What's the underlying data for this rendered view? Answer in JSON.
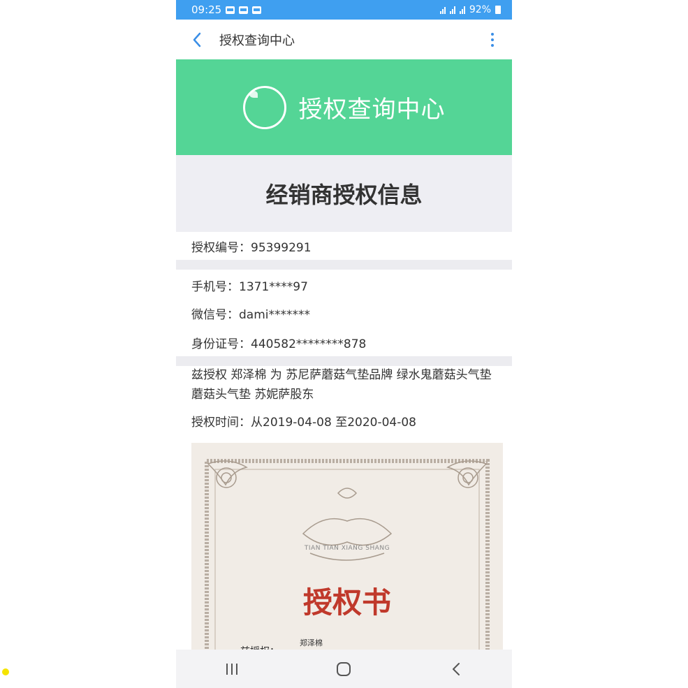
{
  "status_bar": {
    "time": "09:25",
    "battery": "92%"
  },
  "app_bar": {
    "title": "授权查询中心"
  },
  "banner": {
    "title": "授权查询中心"
  },
  "section": {
    "heading": "经销商授权信息"
  },
  "info": {
    "auth_number": "授权编号：95399291",
    "phone": "手机号：1371****97",
    "wechat": "微信号：dami*******",
    "id_card": "身份证号：440582********878"
  },
  "authorization": {
    "statement": "兹授权 郑泽棉 为 苏尼萨蘑菇气垫品牌 绿水鬼蘑菇头气垫 蘑菇头气垫 苏妮萨股东",
    "period": "授权时间：从2019-04-08 至2020-04-08"
  },
  "certificate": {
    "brand_text": "TIAN TIAN XIANG SHANG",
    "title": "授权书",
    "holder_name": "郑泽棉",
    "partial_label": "兹授权："
  },
  "colors": {
    "status_bar": "#3f9ff0",
    "banner": "#54d596",
    "section_bg": "#eeeef3",
    "accent": "#3a8ee6",
    "cert_title": "#c0392b"
  },
  "icons": {
    "back": "chevron-left-icon",
    "more": "more-vertical-icon",
    "nav_recent": "recent-apps-icon",
    "nav_home": "home-icon",
    "nav_back": "back-icon"
  }
}
